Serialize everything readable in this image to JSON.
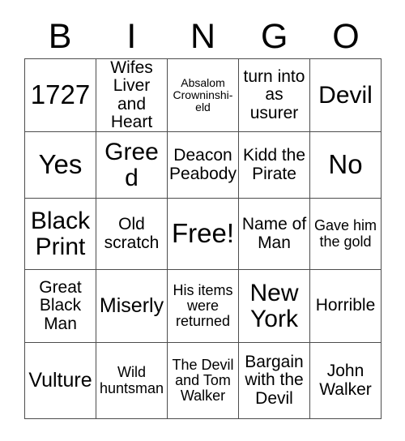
{
  "card": {
    "header_letters": [
      "B",
      "I",
      "N",
      "G",
      "O"
    ],
    "columns": [
      {
        "letter": "B",
        "cells": [
          {
            "text": "1727",
            "size": "xxl"
          },
          {
            "text": "Yes",
            "size": "xxl"
          },
          {
            "text": "Black Print",
            "size": "xl"
          },
          {
            "text": "Great Black Man",
            "size": "md"
          },
          {
            "text": "Vulture",
            "size": "lg"
          }
        ]
      },
      {
        "letter": "I",
        "cells": [
          {
            "text": "Wifes Liver and Heart",
            "size": "md"
          },
          {
            "text": "Greed",
            "size": "xl"
          },
          {
            "text": "Old scratch",
            "size": "md"
          },
          {
            "text": "Miserly",
            "size": "lg"
          },
          {
            "text": "Wild huntsman",
            "size": "sm"
          }
        ]
      },
      {
        "letter": "N",
        "cells": [
          {
            "text": "Absalom Crowninshi-eld",
            "size": "xs"
          },
          {
            "text": "Deacon Peabody",
            "size": "md"
          },
          {
            "text": "Free!",
            "size": "xxl"
          },
          {
            "text": "His items were returned",
            "size": "sm"
          },
          {
            "text": "The Devil and Tom Walker",
            "size": "sm"
          }
        ]
      },
      {
        "letter": "G",
        "cells": [
          {
            "text": "turn into as usurer",
            "size": "md"
          },
          {
            "text": "Kidd the Pirate",
            "size": "md"
          },
          {
            "text": "Name of Man",
            "size": "md"
          },
          {
            "text": "New York",
            "size": "xl"
          },
          {
            "text": "Bargain with the Devil",
            "size": "md"
          }
        ]
      },
      {
        "letter": "O",
        "cells": [
          {
            "text": "Devil",
            "size": "xl"
          },
          {
            "text": "No",
            "size": "xxl"
          },
          {
            "text": "Gave him the gold",
            "size": "sm"
          },
          {
            "text": "Horrible",
            "size": "md"
          },
          {
            "text": "John Walker",
            "size": "md"
          }
        ]
      }
    ],
    "rows": [
      [
        {
          "text": "1727",
          "size": "xxl"
        },
        {
          "text": "Wifes Liver and Heart",
          "size": "md"
        },
        {
          "text": "Absalom Crowninshi-eld",
          "size": "xs"
        },
        {
          "text": "turn into as usurer",
          "size": "md"
        },
        {
          "text": "Devil",
          "size": "xl"
        }
      ],
      [
        {
          "text": "Yes",
          "size": "xxl"
        },
        {
          "text": "Greed",
          "size": "xl"
        },
        {
          "text": "Deacon Peabody",
          "size": "md"
        },
        {
          "text": "Kidd the Pirate",
          "size": "md"
        },
        {
          "text": "No",
          "size": "xxl"
        }
      ],
      [
        {
          "text": "Black Print",
          "size": "xl"
        },
        {
          "text": "Old scratch",
          "size": "md"
        },
        {
          "text": "Free!",
          "size": "xxl"
        },
        {
          "text": "Name of Man",
          "size": "md"
        },
        {
          "text": "Gave him the gold",
          "size": "sm"
        }
      ],
      [
        {
          "text": "Great Black Man",
          "size": "md"
        },
        {
          "text": "Miserly",
          "size": "lg"
        },
        {
          "text": "His items were returned",
          "size": "sm"
        },
        {
          "text": "New York",
          "size": "xl"
        },
        {
          "text": "Horrible",
          "size": "md"
        }
      ],
      [
        {
          "text": "Vulture",
          "size": "lg"
        },
        {
          "text": "Wild huntsman",
          "size": "sm"
        },
        {
          "text": "The Devil and Tom Walker",
          "size": "sm"
        },
        {
          "text": "Bargain with the Devil",
          "size": "md"
        },
        {
          "text": "John Walker",
          "size": "md"
        }
      ]
    ],
    "free_space_text": "Free!",
    "colors": {
      "background": "#ffffff",
      "text": "#000000",
      "grid_line": "#4d4d4d"
    }
  }
}
